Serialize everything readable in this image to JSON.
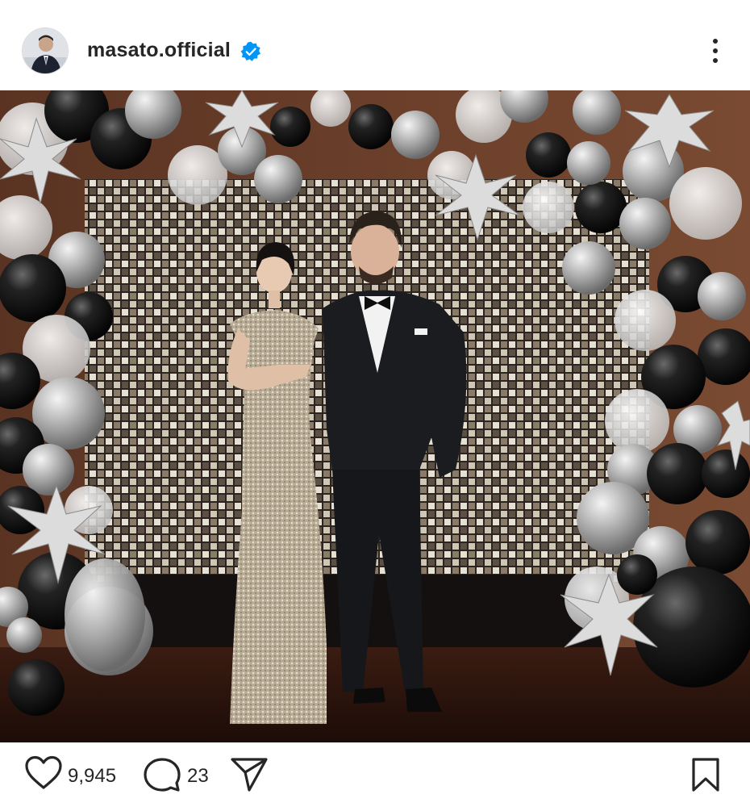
{
  "post": {
    "username": "masato.official",
    "verified": true,
    "likes": "9,945",
    "comments": "23"
  },
  "icons": {
    "avatar": "profile-avatar",
    "verified": "verified-badge-icon",
    "more": "more-options-icon",
    "like": "heart-icon",
    "comment": "comment-bubble-icon",
    "share": "paper-plane-icon",
    "save": "bookmark-icon"
  },
  "colors": {
    "text": "#262626",
    "verified": "#0095f6",
    "background": "#ffffff"
  }
}
